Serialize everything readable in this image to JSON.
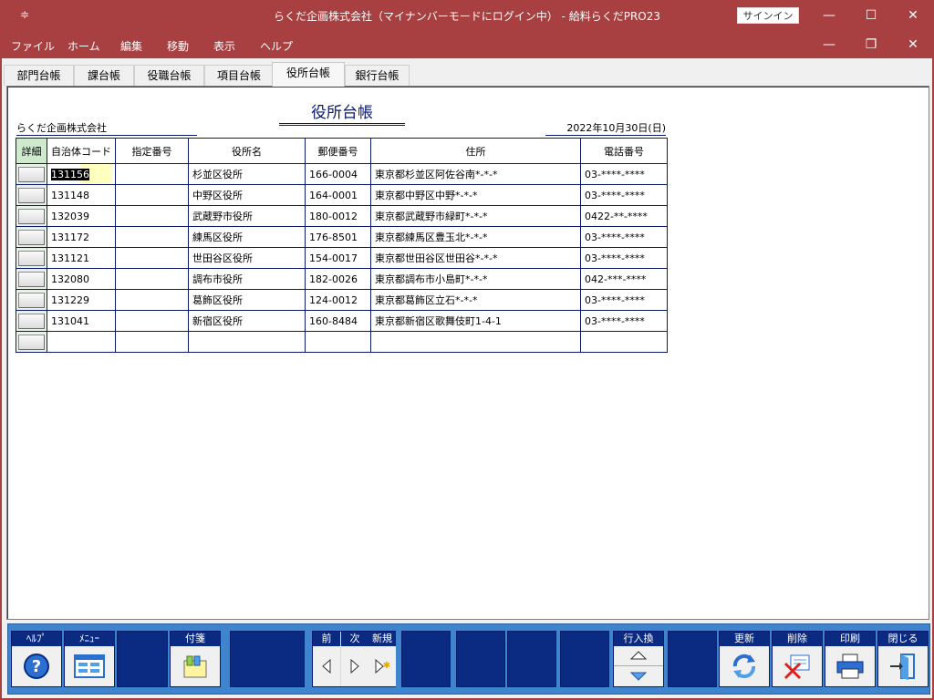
{
  "window": {
    "sysmenu_glyph": "≑",
    "title": "らくだ企画株式会社（マイナンバーモードにログイン中） - 給料らくだPRO23",
    "signin_label": "サインイン",
    "minimize_glyph": "—",
    "maximize_glyph": "☐",
    "close_glyph": "✕"
  },
  "menu": {
    "items": [
      "ファイル",
      "ホーム",
      "編集",
      "移動",
      "表示",
      "ヘルプ"
    ],
    "mdi_min": "—",
    "mdi_restore": "❐",
    "mdi_close": "✕"
  },
  "tabs": [
    "部門台帳",
    "課台帳",
    "役職台帳",
    "項目台帳",
    "役所台帳",
    "銀行台帳"
  ],
  "active_tab": "役所台帳",
  "form": {
    "heading": "役所台帳",
    "company": "らくだ企画株式会社",
    "date": "2022年10月30日(日)"
  },
  "table": {
    "columns": [
      "詳細",
      "自治体コード",
      "指定番号",
      "役所名",
      "郵便番号",
      "住所",
      "電話番号"
    ],
    "rows": [
      {
        "code": "131156",
        "designation": "",
        "office": "杉並区役所",
        "zip": "166-0004",
        "address": "東京都杉並区阿佐谷南*-*-*",
        "phone": "03-****-****"
      },
      {
        "code": "131148",
        "designation": "",
        "office": "中野区役所",
        "zip": "164-0001",
        "address": "東京都中野区中野*-*-*",
        "phone": "03-****-****"
      },
      {
        "code": "132039",
        "designation": "",
        "office": "武蔵野市役所",
        "zip": "180-0012",
        "address": "東京都武蔵野市緑町*-*-*",
        "phone": "0422-**-****"
      },
      {
        "code": "131172",
        "designation": "",
        "office": "練馬区役所",
        "zip": "176-8501",
        "address": "東京都練馬区豊玉北*-*-*",
        "phone": "03-****-****"
      },
      {
        "code": "131121",
        "designation": "",
        "office": "世田谷区役所",
        "zip": "154-0017",
        "address": "東京都世田谷区世田谷*-*-*",
        "phone": "03-****-****"
      },
      {
        "code": "132080",
        "designation": "",
        "office": "調布市役所",
        "zip": "182-0026",
        "address": "東京都調布市小島町*-*-*",
        "phone": "042-***-****"
      },
      {
        "code": "131229",
        "designation": "",
        "office": "葛飾区役所",
        "zip": "124-0012",
        "address": "東京都葛飾区立石*-*-*",
        "phone": "03-****-****"
      },
      {
        "code": "131041",
        "designation": "",
        "office": "新宿区役所",
        "zip": "160-8484",
        "address": "東京都新宿区歌舞伎町1-4-1",
        "phone": "03-****-****"
      },
      {
        "code": "",
        "designation": "",
        "office": "",
        "zip": "",
        "address": "",
        "phone": ""
      }
    ]
  },
  "toolbar": {
    "help": "ﾍﾙﾌﾟ",
    "menu": "ﾒﾆｭｰ",
    "sticky": "付箋",
    "prev": "前",
    "next": "次",
    "new": "新規",
    "row_swap": "行入換",
    "update": "更新",
    "delete": "削除",
    "print": "印刷",
    "close": "閉じる"
  }
}
